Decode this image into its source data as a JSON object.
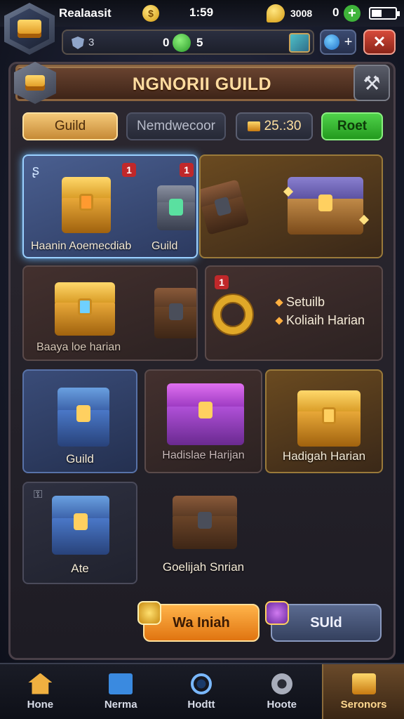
{
  "status_bar": {
    "player_name": "Realaasit",
    "time": "1:59",
    "currency_value": "3008",
    "gem_count": "0"
  },
  "resource_bar": {
    "value_a": "3",
    "value_b": "0",
    "value_c": "5"
  },
  "banner": {
    "title": "NGNORII GUILD"
  },
  "tabs": {
    "guild": "Guild",
    "member": "Nemdwecoor",
    "gold": "25.:30",
    "green": "Roet"
  },
  "cards": {
    "card1_label_left": "Haanin Aoemecdiab",
    "card1_label_right": "Guild",
    "card1_badge_a": "1",
    "card1_badge_b": "1",
    "card3_label": "Baaya loe harian",
    "card4_badge": "1",
    "card4_line1": "Setuilb",
    "card4_line2": "Koliaih Harian",
    "card5_label": "Guild",
    "card6_label": "Hadislae Harijan",
    "card7_label": "Hadigah Harian",
    "card8_label": "Ate",
    "card9_label": "Goelijah Snrian"
  },
  "bottom_buttons": {
    "orange": "Wa Iniah",
    "blue": "SUld"
  },
  "nav": [
    {
      "label": "Hone",
      "icon": "home-icon"
    },
    {
      "label": "Nerma",
      "icon": "check-icon"
    },
    {
      "label": "Hodtt",
      "icon": "target-icon"
    },
    {
      "label": "Hoote",
      "icon": "gear-icon"
    },
    {
      "label": "Seronors",
      "icon": "chest-icon"
    }
  ],
  "colors": {
    "accent_gold": "#f4c878",
    "accent_green": "#3fb43a",
    "close_red": "#d64a3a",
    "panel_bg": "#2c2830"
  }
}
